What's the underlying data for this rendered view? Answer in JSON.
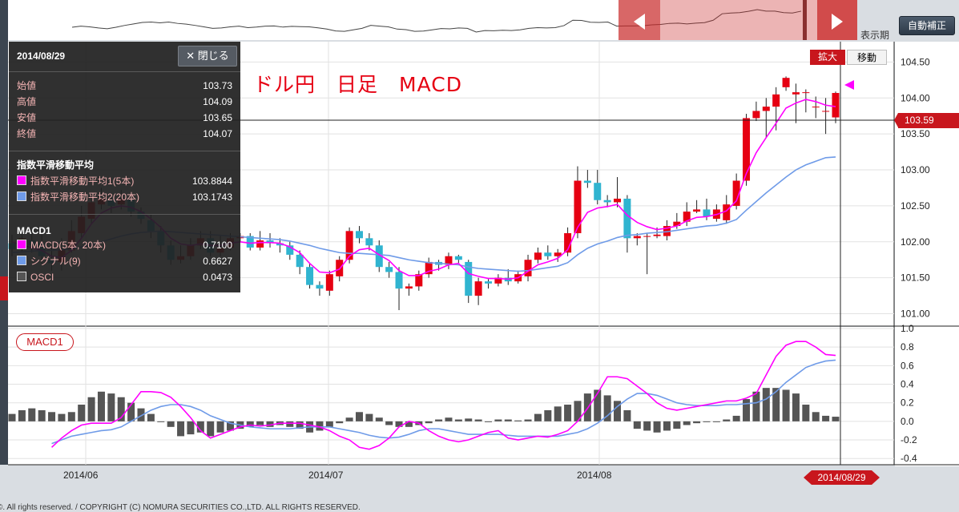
{
  "toolbar": {
    "auto_correct_label": "自動補正",
    "display_period_label": "表示期",
    "zoom_label": "拡大",
    "move_label": "移動"
  },
  "title": "ドル円　日足　MACD",
  "info_panel": {
    "date": "2014/08/29",
    "close_button": "✕ 閉じる",
    "ohlc": [
      {
        "label": "始値",
        "value": "103.73"
      },
      {
        "label": "高値",
        "value": "104.09"
      },
      {
        "label": "安値",
        "value": "103.65"
      },
      {
        "label": "終値",
        "value": "104.07"
      }
    ],
    "ema_header": "指数平滑移動平均",
    "ema_items": [
      {
        "label": "指数平滑移動平均1(5本)",
        "value": "103.8844",
        "color": "#ff00ff"
      },
      {
        "label": "指数平滑移動平均2(20本)",
        "value": "103.1743",
        "color": "#6f9be8"
      }
    ],
    "macd_header": "MACD1",
    "macd_items": [
      {
        "label": "MACD(5本, 20本)",
        "value": "0.7100",
        "color": "#ff00ff"
      },
      {
        "label": "シグナル(9)",
        "value": "0.6627",
        "color": "#6f9be8"
      },
      {
        "label": "OSCI",
        "value": "0.0473",
        "color": "#666666"
      }
    ]
  },
  "macd_tag": "MACD1",
  "last_price_label": "103.59",
  "selected_date_label": "2014/08/29",
  "x_labels": [
    "2014/06",
    "2014/07",
    "2014/08"
  ],
  "copyright": "©. All rights reserved. / COPYRIGHT (C) NOMURA SECURITIES CO.,LTD. ALL RIGHTS RESERVED.",
  "colors": {
    "up": "#e60012",
    "down": "#30b4d0",
    "ema_short": "#ff00ff",
    "ema_long": "#6f9be8",
    "histogram": "#555555"
  },
  "chart_data": [
    {
      "type": "candlestick",
      "title": "ドル円　日足　MACD",
      "y_ticks": [
        "104.50",
        "104.00",
        "103.50",
        "103.00",
        "102.50",
        "102.00",
        "101.50",
        "101.00"
      ],
      "ylim": [
        100.85,
        104.75
      ],
      "grid": true,
      "candles": [
        [
          101.98,
          101.9,
          102.1,
          101.8
        ],
        [
          101.92,
          102.05,
          102.15,
          101.85
        ],
        [
          102.02,
          101.95,
          102.15,
          101.85
        ],
        [
          101.98,
          101.8,
          102.1,
          101.7
        ],
        [
          101.75,
          101.7,
          101.95,
          101.6
        ],
        [
          101.72,
          101.9,
          102.05,
          101.6
        ],
        [
          101.88,
          102.15,
          102.3,
          101.85
        ],
        [
          102.12,
          102.35,
          102.5,
          102.05
        ],
        [
          102.32,
          102.55,
          102.65,
          102.25
        ],
        [
          102.52,
          102.6,
          102.75,
          102.45
        ],
        [
          102.58,
          102.5,
          102.68,
          102.4
        ],
        [
          102.52,
          102.6,
          102.72,
          102.45
        ],
        [
          102.58,
          102.42,
          102.65,
          102.35
        ],
        [
          102.42,
          102.32,
          102.48,
          102.25
        ],
        [
          102.3,
          102.15,
          102.38,
          102.05
        ],
        [
          102.15,
          101.95,
          102.22,
          101.85
        ],
        [
          101.95,
          101.75,
          102.02,
          101.68
        ],
        [
          101.75,
          101.8,
          101.95,
          101.7
        ],
        [
          101.8,
          101.95,
          102.05,
          101.75
        ],
        [
          101.95,
          102.05,
          102.15,
          101.9
        ],
        [
          102.05,
          101.85,
          102.15,
          101.8
        ],
        [
          101.85,
          101.92,
          102.08,
          101.8
        ],
        [
          101.92,
          102.05,
          102.12,
          101.88
        ],
        [
          102.05,
          102.08,
          102.12,
          102.0
        ],
        [
          102.08,
          101.92,
          102.12,
          101.88
        ],
        [
          101.92,
          102.02,
          102.15,
          101.88
        ],
        [
          102.02,
          101.98,
          102.12,
          101.92
        ],
        [
          101.98,
          101.95,
          102.05,
          101.85
        ],
        [
          101.95,
          101.82,
          102.0,
          101.75
        ],
        [
          101.82,
          101.65,
          101.88,
          101.55
        ],
        [
          101.65,
          101.4,
          101.7,
          101.35
        ],
        [
          101.4,
          101.35,
          101.45,
          101.25
        ],
        [
          101.32,
          101.55,
          101.6,
          101.25
        ],
        [
          101.52,
          101.75,
          101.8,
          101.45
        ],
        [
          101.75,
          102.15,
          102.2,
          101.7
        ],
        [
          102.15,
          102.05,
          102.22,
          101.98
        ],
        [
          102.05,
          101.95,
          102.12,
          101.88
        ],
        [
          101.95,
          101.65,
          102.02,
          101.58
        ],
        [
          101.65,
          101.58,
          101.72,
          101.5
        ],
        [
          101.58,
          101.35,
          101.65,
          101.05
        ],
        [
          101.35,
          101.38,
          101.42,
          101.25
        ],
        [
          101.38,
          101.55,
          101.6,
          101.32
        ],
        [
          101.55,
          101.72,
          101.78,
          101.5
        ],
        [
          101.72,
          101.68,
          101.75,
          101.6
        ],
        [
          101.68,
          101.8,
          101.85,
          101.62
        ],
        [
          101.8,
          101.75,
          101.82,
          101.7
        ],
        [
          101.72,
          101.25,
          101.75,
          101.15
        ],
        [
          101.25,
          101.45,
          101.5,
          101.12
        ],
        [
          101.45,
          101.42,
          101.48,
          101.35
        ],
        [
          101.42,
          101.5,
          101.55,
          101.38
        ],
        [
          101.5,
          101.45,
          101.62,
          101.4
        ],
        [
          101.45,
          101.55,
          101.6,
          101.42
        ],
        [
          101.52,
          101.75,
          101.82,
          101.45
        ],
        [
          101.75,
          101.85,
          101.92,
          101.7
        ],
        [
          101.85,
          101.8,
          101.95,
          101.75
        ],
        [
          101.8,
          101.85,
          101.9,
          101.72
        ],
        [
          101.85,
          102.12,
          102.2,
          101.8
        ],
        [
          102.12,
          102.85,
          103.05,
          102.05
        ],
        [
          102.85,
          102.82,
          103.0,
          102.75
        ],
        [
          102.82,
          102.58,
          103.0,
          102.52
        ],
        [
          102.58,
          102.55,
          102.65,
          102.48
        ],
        [
          102.55,
          102.6,
          102.9,
          102.48
        ],
        [
          102.6,
          102.05,
          102.65,
          101.85
        ],
        [
          102.05,
          102.08,
          102.12,
          101.95
        ],
        [
          102.08,
          102.08,
          102.12,
          101.55
        ],
        [
          102.08,
          102.1,
          102.2,
          102.05
        ],
        [
          102.08,
          102.22,
          102.3,
          102.02
        ],
        [
          102.22,
          102.28,
          102.4,
          102.18
        ],
        [
          102.28,
          102.42,
          102.55,
          102.22
        ],
        [
          102.42,
          102.45,
          102.58,
          102.4
        ],
        [
          102.45,
          102.35,
          102.6,
          102.3
        ],
        [
          102.32,
          102.45,
          102.52,
          102.28
        ],
        [
          102.3,
          102.52,
          102.65,
          102.25
        ],
        [
          102.5,
          102.85,
          102.95,
          102.45
        ],
        [
          102.85,
          103.72,
          103.78,
          102.78
        ],
        [
          103.72,
          103.82,
          103.95,
          103.68
        ],
        [
          103.82,
          103.88,
          104.0,
          103.45
        ],
        [
          103.88,
          104.05,
          104.15,
          103.55
        ],
        [
          104.15,
          104.28,
          104.3,
          104.1
        ],
        [
          104.05,
          104.08,
          104.2,
          103.65
        ],
        [
          104.08,
          104.08,
          104.12,
          103.8
        ],
        [
          103.88,
          103.88,
          104.02,
          103.72
        ],
        [
          103.82,
          103.82,
          104.0,
          103.5
        ],
        [
          103.73,
          104.07,
          104.09,
          103.65
        ]
      ],
      "series": [
        {
          "name": "指数平滑移動平均1(5本)",
          "values": [
            102.0,
            101.95,
            101.92,
            101.88,
            101.8,
            101.78,
            101.88,
            102.05,
            102.25,
            102.4,
            102.47,
            102.5,
            102.48,
            102.42,
            102.32,
            102.2,
            102.05,
            101.97,
            101.95,
            101.97,
            101.95,
            101.95,
            101.98,
            102.0,
            101.98,
            101.99,
            101.99,
            101.98,
            101.93,
            101.85,
            101.7,
            101.58,
            101.57,
            101.62,
            101.8,
            101.89,
            101.91,
            101.82,
            101.74,
            101.6,
            101.53,
            101.53,
            101.59,
            101.62,
            101.68,
            101.7,
            101.56,
            101.52,
            101.49,
            101.49,
            101.48,
            101.5,
            101.59,
            101.68,
            101.72,
            101.77,
            101.89,
            102.2,
            102.41,
            102.47,
            102.49,
            102.52,
            102.37,
            102.27,
            102.21,
            102.17,
            102.19,
            102.22,
            102.29,
            102.34,
            102.35,
            102.38,
            102.43,
            102.57,
            102.95,
            103.24,
            103.45,
            103.65,
            103.86,
            103.93,
            103.98,
            103.95,
            103.9,
            103.88
          ]
        },
        {
          "name": "指数平滑移動平均2(20本)",
          "values": [
            101.85,
            101.86,
            101.87,
            101.88,
            101.88,
            101.89,
            101.9,
            101.93,
            101.96,
            102.0,
            102.04,
            102.08,
            102.11,
            102.13,
            102.14,
            102.15,
            102.14,
            102.13,
            102.12,
            102.11,
            102.1,
            102.09,
            102.08,
            102.07,
            102.06,
            102.05,
            102.04,
            102.03,
            102.01,
            101.98,
            101.95,
            101.91,
            101.88,
            101.85,
            101.84,
            101.84,
            101.83,
            101.82,
            101.81,
            101.78,
            101.75,
            101.73,
            101.71,
            101.7,
            101.69,
            101.68,
            101.65,
            101.63,
            101.62,
            101.61,
            101.6,
            101.59,
            101.6,
            101.62,
            101.64,
            101.66,
            101.71,
            101.82,
            101.91,
            101.97,
            102.01,
            102.06,
            102.09,
            102.1,
            102.12,
            102.13,
            102.14,
            102.16,
            102.18,
            102.2,
            102.22,
            102.23,
            102.26,
            102.31,
            102.44,
            102.56,
            102.68,
            102.79,
            102.9,
            103.0,
            103.07,
            103.12,
            103.17,
            103.18
          ]
        }
      ]
    },
    {
      "type": "bar",
      "title": "MACD1",
      "y_ticks": [
        "1.0",
        "0.8",
        "0.6",
        "0.4",
        "0.2",
        "0.0",
        "-0.2",
        "-0.4"
      ],
      "ylim": [
        -0.45,
        1.0
      ],
      "grid": true,
      "histogram": [
        0.08,
        0.12,
        0.14,
        0.12,
        0.1,
        0.08,
        0.1,
        0.18,
        0.26,
        0.32,
        0.3,
        0.26,
        0.2,
        0.14,
        0.08,
        0.0,
        -0.06,
        -0.16,
        -0.14,
        -0.12,
        -0.16,
        -0.12,
        -0.1,
        -0.08,
        -0.06,
        -0.04,
        -0.06,
        -0.04,
        -0.06,
        -0.08,
        -0.12,
        -0.1,
        -0.06,
        -0.02,
        0.04,
        0.1,
        0.08,
        0.04,
        -0.04,
        -0.06,
        -0.06,
        -0.04,
        -0.02,
        0.02,
        0.04,
        0.02,
        0.03,
        0.02,
        0.0,
        0.02,
        0.02,
        0.01,
        0.02,
        0.08,
        0.12,
        0.16,
        0.18,
        0.22,
        0.3,
        0.34,
        0.28,
        0.22,
        0.12,
        -0.08,
        -0.1,
        -0.12,
        -0.1,
        -0.08,
        -0.04,
        -0.02,
        0.0,
        0.0,
        0.02,
        0.06,
        0.24,
        0.32,
        0.36,
        0.36,
        0.34,
        0.3,
        0.18,
        0.1,
        0.06,
        0.05
      ],
      "series": [
        {
          "name": "MACD(5本, 20本)",
          "values": [
            -0.28,
            -0.18,
            -0.1,
            -0.04,
            -0.02,
            -0.02,
            -0.02,
            0.04,
            0.18,
            0.32,
            0.32,
            0.31,
            0.26,
            0.16,
            0.04,
            -0.1,
            -0.18,
            -0.14,
            -0.1,
            -0.06,
            -0.04,
            -0.05,
            -0.04,
            -0.02,
            -0.02,
            -0.02,
            -0.04,
            -0.06,
            -0.1,
            -0.16,
            -0.2,
            -0.28,
            -0.3,
            -0.26,
            -0.18,
            -0.06,
            0.0,
            -0.02,
            -0.1,
            -0.16,
            -0.2,
            -0.22,
            -0.2,
            -0.16,
            -0.12,
            -0.1,
            -0.18,
            -0.2,
            -0.18,
            -0.16,
            -0.17,
            -0.14,
            -0.1,
            0.0,
            0.14,
            0.3,
            0.48,
            0.48,
            0.46,
            0.38,
            0.3,
            0.2,
            0.14,
            0.12,
            0.14,
            0.16,
            0.18,
            0.2,
            0.22,
            0.22,
            0.25,
            0.3,
            0.5,
            0.7,
            0.82,
            0.86,
            0.86,
            0.8,
            0.72,
            0.71
          ]
        },
        {
          "name": "シグナル(9)",
          "values": [
            -0.24,
            -0.2,
            -0.16,
            -0.14,
            -0.12,
            -0.1,
            -0.09,
            -0.06,
            0.0,
            0.06,
            0.12,
            0.16,
            0.18,
            0.18,
            0.16,
            0.12,
            0.06,
            0.02,
            -0.02,
            -0.04,
            -0.06,
            -0.07,
            -0.08,
            -0.08,
            -0.08,
            -0.07,
            -0.06,
            -0.06,
            -0.06,
            -0.08,
            -0.1,
            -0.12,
            -0.15,
            -0.17,
            -0.18,
            -0.17,
            -0.14,
            -0.1,
            -0.08,
            -0.08,
            -0.1,
            -0.12,
            -0.14,
            -0.14,
            -0.14,
            -0.14,
            -0.15,
            -0.16,
            -0.16,
            -0.16,
            -0.16,
            -0.16,
            -0.14,
            -0.12,
            -0.08,
            -0.02,
            0.06,
            0.16,
            0.24,
            0.3,
            0.3,
            0.28,
            0.24,
            0.2,
            0.18,
            0.17,
            0.17,
            0.17,
            0.18,
            0.18,
            0.19,
            0.2,
            0.24,
            0.32,
            0.42,
            0.5,
            0.58,
            0.62,
            0.65,
            0.66
          ]
        }
      ]
    }
  ]
}
